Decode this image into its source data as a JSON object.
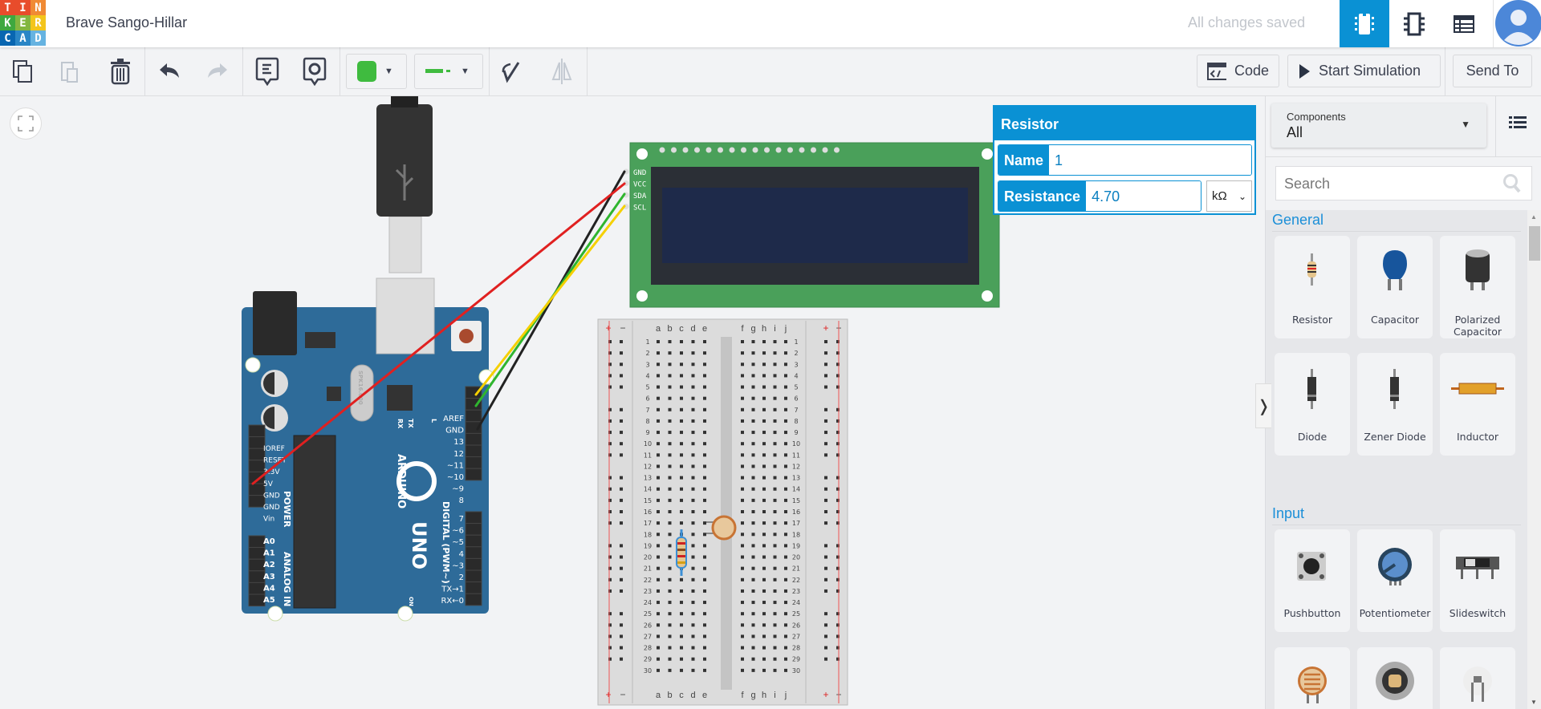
{
  "header": {
    "logo": [
      "T",
      "I",
      "N",
      "K",
      "E",
      "R",
      "C",
      "A",
      "D"
    ],
    "logo_colors": [
      "#e84c2b",
      "#e84c2b",
      "#f08a34",
      "#3ea83f",
      "#83b640",
      "#f3c51c",
      "#0866b1",
      "#2a86c6",
      "#66b3e1"
    ],
    "title": "Brave Sango-Hillar",
    "status": "All changes saved",
    "tabs": [
      {
        "icon": "circuit-view-icon",
        "active": true
      },
      {
        "icon": "schematic-view-icon"
      },
      {
        "icon": "component-list-icon"
      }
    ],
    "accent": "#0a91d4"
  },
  "toolbar": {
    "code_label": "Code",
    "simulate_label": "Start Simulation",
    "send_label": "Send To",
    "wire_color": "#3fbb3f"
  },
  "properties": {
    "title": "Resistor",
    "name_label": "Name",
    "name_value": "1",
    "resistance_label": "Resistance",
    "resistance_value": "4.70",
    "unit": "kΩ"
  },
  "panel": {
    "dropdown_label": "Components",
    "dropdown_value": "All",
    "search_placeholder": "Search",
    "sections": [
      {
        "title": "General",
        "items": [
          "Resistor",
          "Capacitor",
          "Polarized Capacitor",
          "Diode",
          "Zener Diode",
          "Inductor"
        ]
      },
      {
        "title": "Input",
        "items": [
          "Pushbutton",
          "Potentiometer",
          "Slideswitch"
        ]
      }
    ]
  },
  "circuit": {
    "lcd_pins": [
      "GND",
      "VCC",
      "SDA",
      "SCL"
    ],
    "arduino": {
      "brand": "ARDUINO",
      "model": "UNO",
      "power_pins": [
        "IOREF",
        "RESET",
        "3.3V",
        "5V",
        "GND",
        "GND",
        "Vin"
      ],
      "power_label": "POWER",
      "analog_pins": [
        "A0",
        "A1",
        "A2",
        "A3",
        "A4",
        "A5"
      ],
      "analog_label": "ANALOG IN",
      "digital_top": [
        "AREF",
        "GND",
        "13",
        "12",
        "~11",
        "~10",
        "~9",
        "8"
      ],
      "digital_bottom": [
        "7",
        "~6",
        "~5",
        "4",
        "~3",
        "2",
        "TX→1",
        "RX←0"
      ],
      "digital_label": "DIGITAL (PWM~)",
      "leds": [
        "RX",
        "TX",
        "L"
      ],
      "on_label": "ON",
      "crystal": "SPK16.000"
    },
    "breadboard": {
      "cols_left": [
        "a",
        "b",
        "c",
        "d",
        "e"
      ],
      "cols_right": [
        "f",
        "g",
        "h",
        "i",
        "j"
      ],
      "rows": 30,
      "plus": "+",
      "minus": "−"
    },
    "wires": [
      {
        "from": "GND",
        "color": "#222222"
      },
      {
        "from": "VCC",
        "color": "#e02020"
      },
      {
        "from": "SDA",
        "color": "#2fb52f"
      },
      {
        "from": "SCL",
        "color": "#f5d000"
      }
    ]
  }
}
